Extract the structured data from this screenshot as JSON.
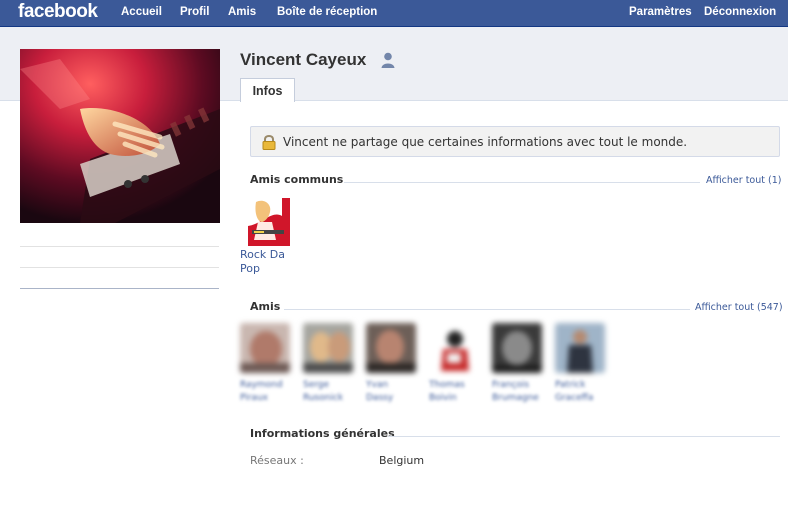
{
  "topbar": {
    "logo": "facebook",
    "nav": [
      "Accueil",
      "Profil",
      "Amis",
      "Boîte de réception"
    ],
    "right": [
      "Paramètres",
      "Déconnexion"
    ]
  },
  "profile": {
    "name": "Vincent Cayeux",
    "tab": "Infos",
    "privacy_notice": "Vincent ne partage que certaines informations avec tout le monde."
  },
  "mutual_friends": {
    "title": "Amis communs",
    "see_all": "Afficher tout (1)",
    "items": [
      {
        "name": "Rock Da Pop"
      }
    ]
  },
  "friends": {
    "title": "Amis",
    "see_all": "Afficher tout (547)",
    "items": [
      {
        "name": "Raymond Piraux"
      },
      {
        "name": "Serge Rusonick"
      },
      {
        "name": "Yvan Dassy"
      },
      {
        "name": "Thomas Boivin"
      },
      {
        "name": "François Brumagne"
      },
      {
        "name": "Patrick Graceffa"
      }
    ]
  },
  "general_info": {
    "title": "Informations générales",
    "rows": [
      {
        "label": "Réseaux :",
        "value": "Belgium"
      }
    ]
  },
  "colors": {
    "brand_blue": "#3b5998",
    "link_blue": "#3b5998",
    "band_grey": "#edeff4"
  }
}
